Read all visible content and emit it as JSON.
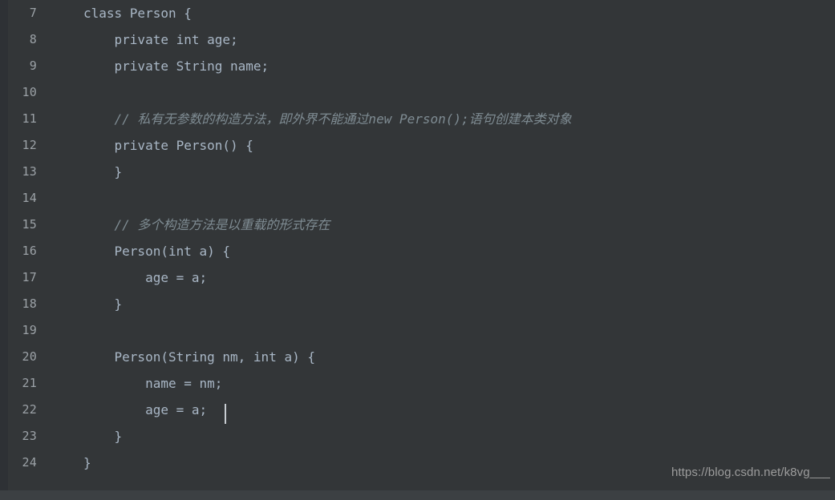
{
  "editor": {
    "language": "java",
    "theme_name": "darcula",
    "background_color": "#333638",
    "gutter_color": "#2e3135",
    "text_color": "#a9b7c6",
    "line_number_color": "#9ba1a6",
    "comment_color": "#7f8c93",
    "caret_color": "#c8cdd2",
    "lines": [
      {
        "number": "7",
        "text": "class Person {",
        "comment": false
      },
      {
        "number": "8",
        "text": "    private int age;",
        "comment": false
      },
      {
        "number": "9",
        "text": "    private String name;",
        "comment": false
      },
      {
        "number": "10",
        "text": "",
        "comment": false
      },
      {
        "number": "11",
        "text": "    // 私有无参数的构造方法，即外界不能通过new Person();语句创建本类对象",
        "comment": true
      },
      {
        "number": "12",
        "text": "    private Person() {",
        "comment": false
      },
      {
        "number": "13",
        "text": "    }",
        "comment": false
      },
      {
        "number": "14",
        "text": "",
        "comment": false
      },
      {
        "number": "15",
        "text": "    // 多个构造方法是以重载的形式存在",
        "comment": true
      },
      {
        "number": "16",
        "text": "    Person(int a) {",
        "comment": false
      },
      {
        "number": "17",
        "text": "        age = a;",
        "comment": false
      },
      {
        "number": "18",
        "text": "    }",
        "comment": false
      },
      {
        "number": "19",
        "text": "",
        "comment": false
      },
      {
        "number": "20",
        "text": "    Person(String nm, int a) {",
        "comment": false
      },
      {
        "number": "21",
        "text": "        name = nm;",
        "comment": false
      },
      {
        "number": "22",
        "text": "        age = a;",
        "comment": false
      },
      {
        "number": "23",
        "text": "    }",
        "comment": false
      },
      {
        "number": "24",
        "text": "}",
        "comment": false
      }
    ]
  },
  "watermark": {
    "text": "https://blog.csdn.net/k8vg___"
  }
}
